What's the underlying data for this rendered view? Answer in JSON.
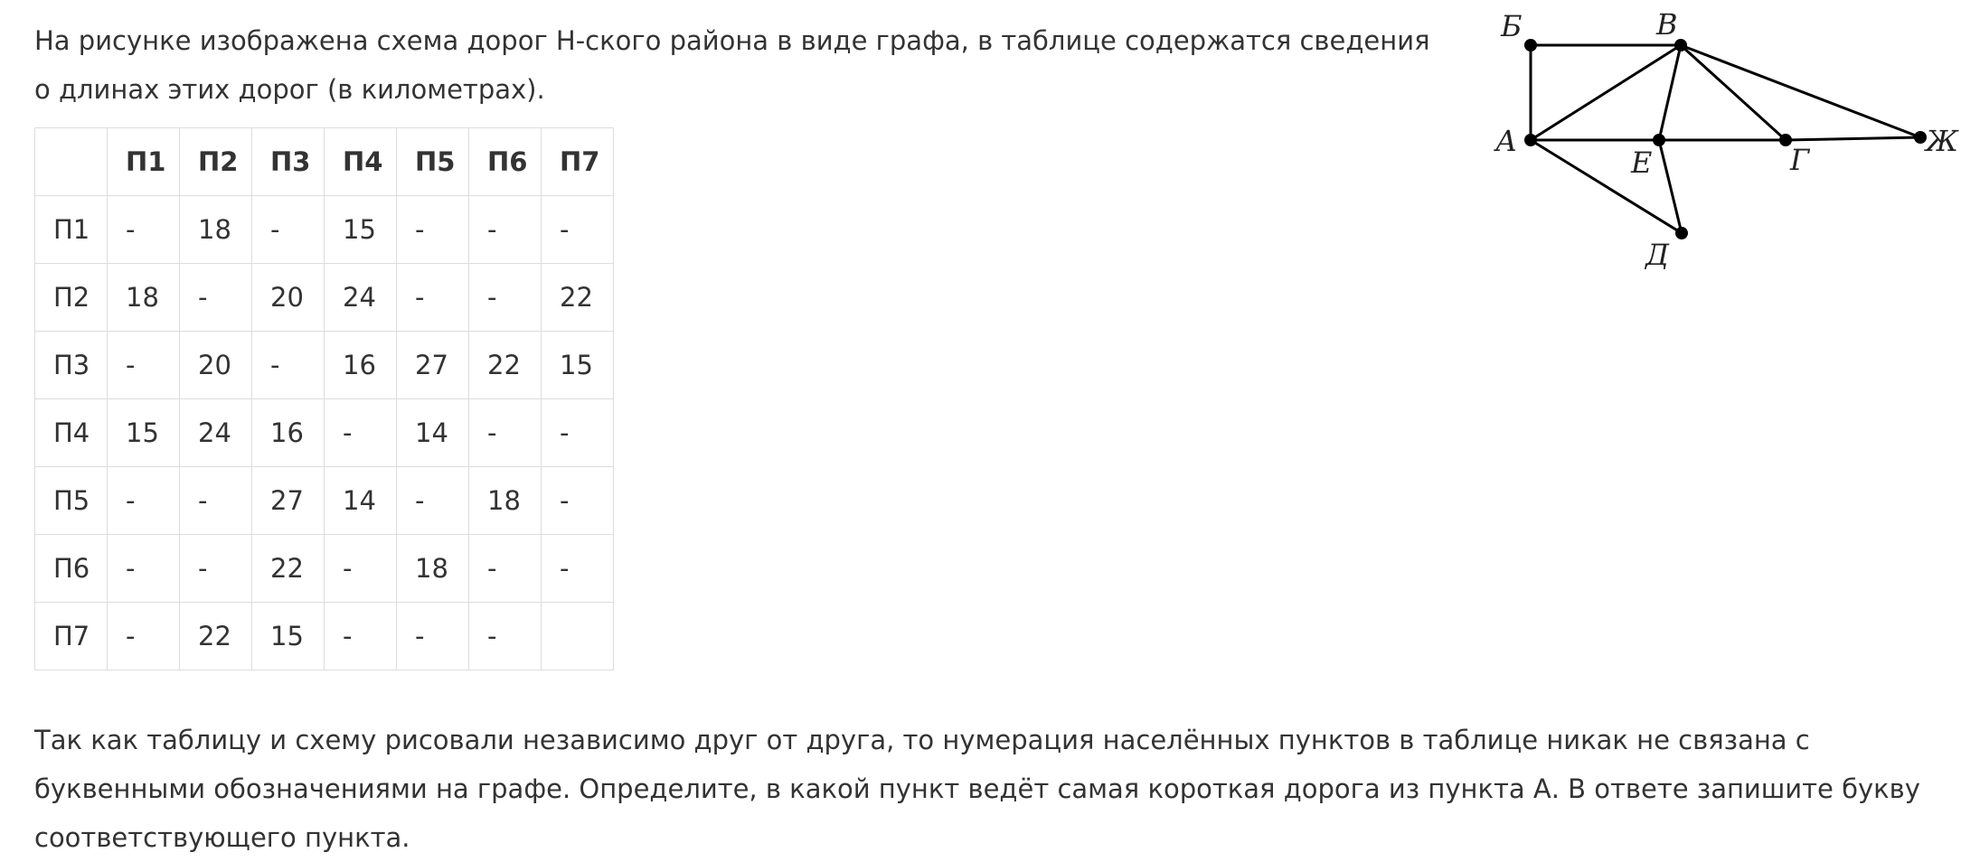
{
  "intro_text": "На рисунке изображена схема дорог Н-ского района в виде графа, в таблице содержатся сведения о длинах этих дорог (в километрах).",
  "table": {
    "corner": "",
    "headers": [
      "П1",
      "П2",
      "П3",
      "П4",
      "П5",
      "П6",
      "П7"
    ],
    "rows": [
      {
        "label": "П1",
        "cells": [
          "-",
          "18",
          "-",
          "15",
          "-",
          "-",
          "-"
        ]
      },
      {
        "label": "П2",
        "cells": [
          "18",
          "-",
          "20",
          "24",
          "-",
          "-",
          "22"
        ]
      },
      {
        "label": "П3",
        "cells": [
          "-",
          "20",
          "-",
          "16",
          "27",
          "22",
          "15"
        ]
      },
      {
        "label": "П4",
        "cells": [
          "15",
          "24",
          "16",
          "-",
          "14",
          "-",
          "-"
        ]
      },
      {
        "label": "П5",
        "cells": [
          "-",
          "-",
          "27",
          "14",
          "-",
          "18",
          "-"
        ]
      },
      {
        "label": "П6",
        "cells": [
          "-",
          "-",
          "22",
          "-",
          "18",
          "-",
          "-"
        ]
      },
      {
        "label": "П7",
        "cells": [
          "-",
          "22",
          "15",
          "-",
          "-",
          "-",
          ""
        ]
      }
    ]
  },
  "outro_text": "Так как таблицу и схему рисовали независимо друг от друга, то нумерация населённых пунктов в таблице никак не связана с буквенными обозначениями на графе. Определите, в какой пункт ведёт самая короткая дорога из пункта А. В ответе запишите букву соответствующего пункта.",
  "graph": {
    "nodes": [
      "А",
      "Б",
      "В",
      "Г",
      "Д",
      "Е",
      "Ж"
    ],
    "edges": [
      [
        "Б",
        "В"
      ],
      [
        "Б",
        "А"
      ],
      [
        "А",
        "В"
      ],
      [
        "А",
        "Е"
      ],
      [
        "Е",
        "Г"
      ],
      [
        "Г",
        "Ж"
      ],
      [
        "А",
        "Д"
      ],
      [
        "Е",
        "Д"
      ],
      [
        "В",
        "Е"
      ],
      [
        "В",
        "Г"
      ],
      [
        "В",
        "Ж"
      ]
    ],
    "stroke_color": "#000000"
  }
}
